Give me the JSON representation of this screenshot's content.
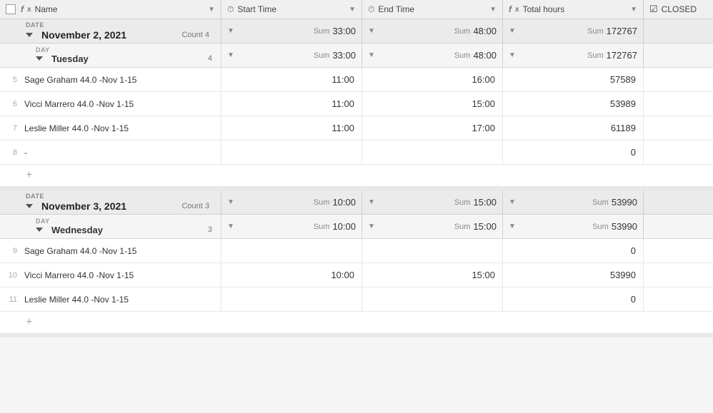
{
  "header": {
    "columns": [
      {
        "id": "name",
        "icon": "checkbox",
        "label": "Name",
        "type": "name"
      },
      {
        "id": "start_time",
        "icon": "clock",
        "label": "Start Time",
        "type": "formula"
      },
      {
        "id": "end_time",
        "icon": "clock",
        "label": "End Time",
        "type": "formula"
      },
      {
        "id": "total_hours",
        "icon": "fx",
        "label": "Total hours",
        "type": "formula"
      },
      {
        "id": "closed",
        "icon": "check",
        "label": "CLOSED",
        "type": "check"
      }
    ]
  },
  "sections": [
    {
      "date_label": "DATE",
      "date_title": "November 2, 2021",
      "count": 4,
      "count_label": "Count",
      "sum_start": "33:00",
      "sum_end": "48:00",
      "sum_total": "172767",
      "days": [
        {
          "day_label": "DAY",
          "day_title": "Tuesday",
          "count": 4,
          "sum_start": "33:00",
          "sum_end": "48:00",
          "sum_total": "172767",
          "rows": [
            {
              "num": 5,
              "name": "Sage Graham 44.0 -Nov 1-15",
              "start": "11:00",
              "end": "16:00",
              "total": "57589"
            },
            {
              "num": 6,
              "name": "Vicci Marrero 44.0 -Nov 1-15",
              "start": "11:00",
              "end": "15:00",
              "total": "53989"
            },
            {
              "num": 7,
              "name": "Leslie Miller 44.0 -Nov 1-15",
              "start": "11:00",
              "end": "17:00",
              "total": "61189"
            },
            {
              "num": 8,
              "name": "-",
              "start": "",
              "end": "",
              "total": "0"
            }
          ]
        }
      ]
    },
    {
      "date_label": "DATE",
      "date_title": "November 3, 2021",
      "count": 3,
      "count_label": "Count",
      "sum_start": "10:00",
      "sum_end": "15:00",
      "sum_total": "53990",
      "days": [
        {
          "day_label": "DAY",
          "day_title": "Wednesday",
          "count": 3,
          "sum_start": "10:00",
          "sum_end": "15:00",
          "sum_total": "53990",
          "rows": [
            {
              "num": 9,
              "name": "Sage Graham 44.0 -Nov 1-15",
              "start": "",
              "end": "",
              "total": "0"
            },
            {
              "num": 10,
              "name": "Vicci Marrero 44.0 -Nov 1-15",
              "start": "10:00",
              "end": "15:00",
              "total": "53990"
            },
            {
              "num": 11,
              "name": "Leslie Miller 44.0 -Nov 1-15",
              "start": "",
              "end": "",
              "total": "0"
            }
          ]
        }
      ]
    }
  ],
  "add_label": "+",
  "sum_prefix": "Sum"
}
